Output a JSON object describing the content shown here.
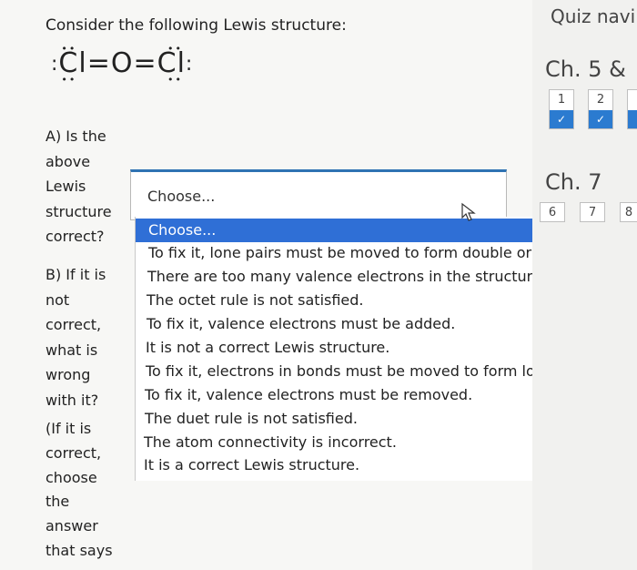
{
  "question": {
    "intro": "Consider the following Lewis structure:",
    "lewis": {
      "left_atom": "Cl",
      "center_atom": "O",
      "right_atom": "Cl",
      "bond": "="
    },
    "part_a": [
      "A) Is the",
      "above",
      "Lewis",
      "structure",
      "correct?"
    ],
    "part_b": [
      "B) If it is",
      "not",
      "correct,",
      "what is",
      "wrong",
      "with it?"
    ],
    "part_c": [
      "(If it is",
      "correct,",
      "choose",
      "the",
      "answer",
      "that says"
    ]
  },
  "dropdown": {
    "selected": "Choose...",
    "options": [
      "Choose...",
      "To fix it, lone pairs must be moved to form double or triple bonds",
      "There are too many valence electrons in the structure.",
      "The octet rule is not satisfied.",
      "To fix it, valence electrons must be added.",
      "It is not a correct Lewis structure.",
      "To fix it, electrons in bonds must be moved to form lone pairs.",
      "To fix it, valence electrons must be removed.",
      "The duet rule is not satisfied.",
      "The atom connectivity is incorrect.",
      "It is a correct Lewis structure."
    ]
  },
  "quiz_nav": {
    "title": "Quiz navi",
    "chapters": [
      {
        "label": "Ch. 5 &",
        "questions": [
          {
            "num": "1",
            "done": true,
            "check": "✓"
          },
          {
            "num": "2",
            "done": true,
            "check": "✓"
          }
        ]
      },
      {
        "label": "Ch. 7",
        "questions": [
          {
            "num": "6",
            "done": false
          },
          {
            "num": "7",
            "done": false
          },
          {
            "num": "8",
            "done": false
          }
        ]
      }
    ]
  }
}
